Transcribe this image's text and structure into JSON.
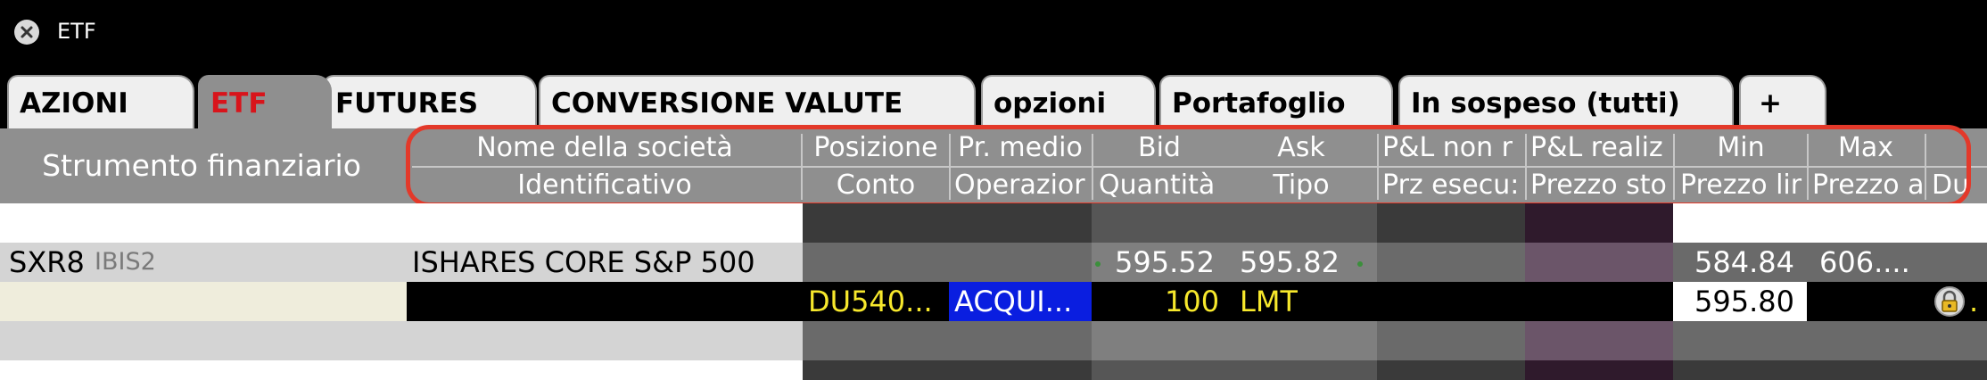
{
  "window": {
    "title": "ETF"
  },
  "tabs": [
    {
      "label": "AZIONI"
    },
    {
      "label": "ETF"
    },
    {
      "label": "FUTURES"
    },
    {
      "label": "CONVERSIONE VALUTE"
    },
    {
      "label": "opzioni"
    },
    {
      "label": "Portafoglio"
    },
    {
      "label": "In sospeso (tutti)"
    },
    {
      "label": "+"
    }
  ],
  "header": {
    "instrument": "Strumento finanziario",
    "columns": [
      {
        "top": "Nome della società",
        "bottom": "Identificativo"
      },
      {
        "top": "Posizione",
        "bottom": "Conto"
      },
      {
        "top": "Pr. medio",
        "bottom": "Operazior"
      },
      {
        "top": "Bid",
        "bottom": "Quantità"
      },
      {
        "top": "Ask",
        "bottom": "Tipo"
      },
      {
        "top": "P&L non r",
        "bottom": "Prz esecu:"
      },
      {
        "top": "P&L realiz",
        "bottom": "Prezzo sto"
      },
      {
        "top": "Min",
        "bottom": "Prezzo lir"
      },
      {
        "top": "Max",
        "bottom": "Prezzo a"
      },
      {
        "top": "",
        "bottom": "Du"
      }
    ]
  },
  "rows": {
    "etf": {
      "symbol": "SXR8",
      "exchange": "IBIS2",
      "name": "ISHARES CORE S&P 500",
      "bid": "595.52",
      "ask": "595.82",
      "low": "584.84",
      "high": "606...."
    },
    "order": {
      "account": "DU540...",
      "action": "ACQUI...",
      "quantity": "100",
      "type": "LMT",
      "limit_price": "595.80",
      "duration_tail": "."
    }
  },
  "colors": {
    "tab_active_text": "#d8141b",
    "highlight_border": "#e3392a",
    "order_text": "#f7e82c",
    "action_bg": "#0a1ee0"
  },
  "icons": {
    "close": "close-icon",
    "lock": "lock-icon"
  }
}
